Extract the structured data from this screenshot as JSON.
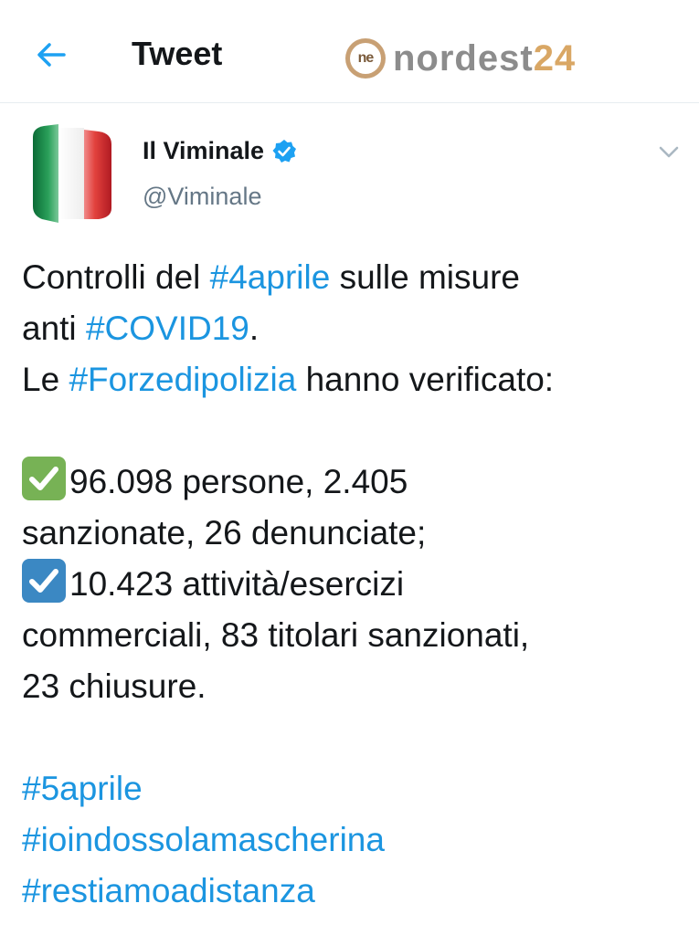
{
  "header": {
    "title": "Tweet",
    "brand_icon_text": "ne",
    "brand_name_a": "nordest",
    "brand_name_b": "24"
  },
  "account": {
    "name": "Il Viminale",
    "handle": "@Viminale",
    "verified": true
  },
  "tweet": {
    "l1_a": "Controlli del ",
    "l1_tag": "#4aprile",
    "l1_b": " sulle misure",
    "l2_a": "anti ",
    "l2_tag": "#COVID19",
    "l2_b": ".",
    "l3_a": "Le ",
    "l3_tag": "#Forzedipolizia",
    "l3_b": " hanno verificato:",
    "l4": "96.098 persone, 2.405",
    "l5": "sanzionate, 26 denunciate;",
    "l6": "10.423 attività/esercizi",
    "l7": "commerciali, 83 titolari sanzionati,",
    "l8": "23 chiusure.",
    "tag_a": "#5aprile",
    "tag_b": "#ioindossolamascherina",
    "tag_c": "#restiamoadistanza"
  },
  "icons": {
    "back": "arrow-left-icon",
    "verified": "verified-badge-icon",
    "chevron": "chevron-down-icon",
    "check_green": "white-check-mark-icon",
    "check_blue": "ballot-box-check-icon"
  },
  "colors": {
    "accent": "#1da1f2",
    "hashtag": "#1b95e0",
    "text": "#14171a",
    "muted": "#657786",
    "flag_green": "#009246",
    "flag_red": "#ce2b37",
    "brand_gray": "#8c8c8c",
    "brand_gold": "#d9a765"
  }
}
